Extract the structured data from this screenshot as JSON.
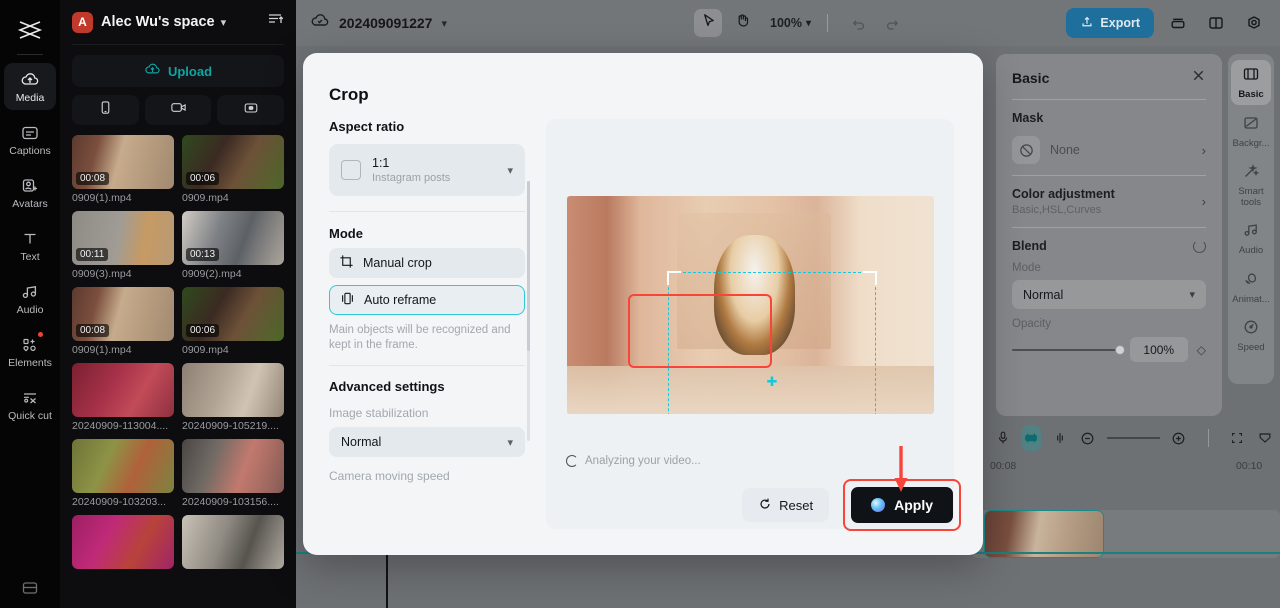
{
  "app": {
    "left_rail": {
      "logo_icon": "capcut-logo-icon",
      "items": [
        {
          "label": "Media",
          "icon": "cloud-upload-icon",
          "active": true,
          "badge": false
        },
        {
          "label": "Captions",
          "icon": "captions-icon",
          "active": false,
          "badge": false
        },
        {
          "label": "Avatars",
          "icon": "avatar-add-icon",
          "active": false,
          "badge": false
        },
        {
          "label": "Text",
          "icon": "text-t-icon",
          "active": false,
          "badge": false
        },
        {
          "label": "Audio",
          "icon": "music-note-icon",
          "active": false,
          "badge": false
        },
        {
          "label": "Elements",
          "icon": "shapes-icon",
          "active": false,
          "badge": true
        },
        {
          "label": "Quick cut",
          "icon": "quick-cut-icon",
          "active": false,
          "badge": false
        }
      ],
      "bottom_icon": "layout-grid-icon"
    },
    "media_panel": {
      "avatar_initial": "A",
      "space_title": "Alec Wu's space",
      "dropdown_icon": "chevron-down-icon",
      "sort_icon": "sort-icon",
      "upload_label": "Upload",
      "upload_icon": "cloud-upload-icon",
      "quick_actions": [
        {
          "icon": "phone-icon",
          "name": "import-from-phone"
        },
        {
          "icon": "camera-record-icon",
          "name": "record-video"
        },
        {
          "icon": "screen-record-icon",
          "name": "record-screen"
        }
      ],
      "items": [
        {
          "name": "0909(1).mp4",
          "duration": "00:08",
          "kind": "corgi"
        },
        {
          "name": "0909.mp4",
          "duration": "00:06",
          "kind": "puppies"
        },
        {
          "name": "0909(3).mp4",
          "duration": "00:11",
          "kind": "orangecat"
        },
        {
          "name": "0909(2).mp4",
          "duration": "00:13",
          "kind": "greycat"
        },
        {
          "name": "0909(1).mp4",
          "duration": "00:08",
          "kind": "corgi"
        },
        {
          "name": "0909.mp4",
          "duration": "00:06",
          "kind": "puppies"
        },
        {
          "name": "20240909-113004....",
          "duration": "",
          "kind": "redlady"
        },
        {
          "name": "20240909-105219....",
          "duration": "",
          "kind": "shopping"
        },
        {
          "name": "20240909-103203...",
          "duration": "",
          "kind": "mirror"
        },
        {
          "name": "20240909-103156....",
          "duration": "",
          "kind": "lipstick"
        },
        {
          "name": "",
          "duration": "",
          "kind": "nails"
        },
        {
          "name": "",
          "duration": "",
          "kind": "palette"
        }
      ]
    }
  },
  "topbar": {
    "cloud_icon": "cloud-check-icon",
    "project_name": "202409091227",
    "project_dropdown_icon": "chevron-down-icon",
    "tools": [
      {
        "name": "select-tool",
        "icon": "cursor-arrow-icon",
        "selected": true
      },
      {
        "name": "hand-tool",
        "icon": "hand-icon",
        "selected": false
      }
    ],
    "zoom_level": "100%",
    "zoom_chevron_icon": "chevron-down-icon",
    "undo_icon": "undo-icon",
    "redo_icon": "redo-icon",
    "export_label": "Export",
    "export_icon": "export-upload-icon",
    "export_color": "#1f6f9c",
    "right_icons": [
      {
        "name": "stack-layers-icon"
      },
      {
        "name": "split-layout-icon"
      },
      {
        "name": "settings-gear-icon"
      }
    ]
  },
  "inspector": {
    "title": "Basic",
    "close_icon": "close-icon",
    "mask": {
      "label": "Mask",
      "value": "None",
      "icon": "no-mask-icon",
      "chevron": "chevron-right-icon"
    },
    "color_adjustment": {
      "label": "Color adjustment",
      "sub": "Basic,HSL,Curves",
      "chevron": "chevron-right-icon"
    },
    "blend": {
      "label": "Blend",
      "reset_icon": "reset-circle-icon",
      "mode_label": "Mode",
      "mode_value": "Normal",
      "opacity_label": "Opacity",
      "opacity_value": "100%",
      "keyframe_icon": "diamond-keyframe-icon"
    }
  },
  "right_rail": {
    "items": [
      {
        "label": "Basic",
        "icon": "film-frame-icon",
        "active": true
      },
      {
        "label": "Backgr...",
        "icon": "background-icon",
        "active": false
      },
      {
        "label": "Smart tools",
        "icon": "magic-wand-icon",
        "active": false
      },
      {
        "label": "Audio",
        "icon": "music-note-icon",
        "active": false
      },
      {
        "label": "Animat...",
        "icon": "animation-icon",
        "active": false
      },
      {
        "label": "Speed",
        "icon": "speed-gauge-icon",
        "active": false
      }
    ]
  },
  "timeline": {
    "tools": [
      {
        "name": "microphone-icon",
        "active": false
      },
      {
        "name": "auto-captions-icon",
        "active": true
      },
      {
        "name": "split-clip-icon",
        "active": false
      },
      {
        "name": "zoom-out-icon",
        "active": false
      }
    ],
    "tools_right": [
      {
        "name": "zoom-in-icon"
      },
      {
        "name": "fit-to-screen-icon"
      },
      {
        "name": "timeline-view-icon"
      }
    ],
    "ruler_marks": [
      "00:08",
      "00:10"
    ]
  },
  "crop_dialog": {
    "title": "Crop",
    "close_icon": "close-icon",
    "aspect_ratio": {
      "label": "Aspect ratio",
      "value": "1:1",
      "sub": "Instagram posts",
      "chevron_icon": "chevron-down-icon"
    },
    "mode": {
      "label": "Mode",
      "options": [
        {
          "label": "Manual crop",
          "icon": "manual-crop-icon",
          "selected": false
        },
        {
          "label": "Auto reframe",
          "icon": "auto-reframe-icon",
          "selected": true
        }
      ],
      "hint": "Main objects will be recognized and kept in the frame."
    },
    "advanced": {
      "label": "Advanced settings",
      "stabilization_label": "Image stabilization",
      "stabilization_value": "Normal",
      "stabilization_chevron": "chevron-down-icon",
      "camera_speed_label": "Camera moving speed"
    },
    "preview": {
      "status_text": "Analyzing your video...",
      "spinner_icon": "loading-spinner-icon"
    },
    "footer": {
      "reset_label": "Reset",
      "reset_icon": "reset-circle-icon",
      "apply_label": "Apply",
      "apply_icon": "ai-orb-icon"
    },
    "annotations": {
      "highlight_color": "#f8453a",
      "arrow_icon": "red-down-arrow-icon"
    }
  }
}
